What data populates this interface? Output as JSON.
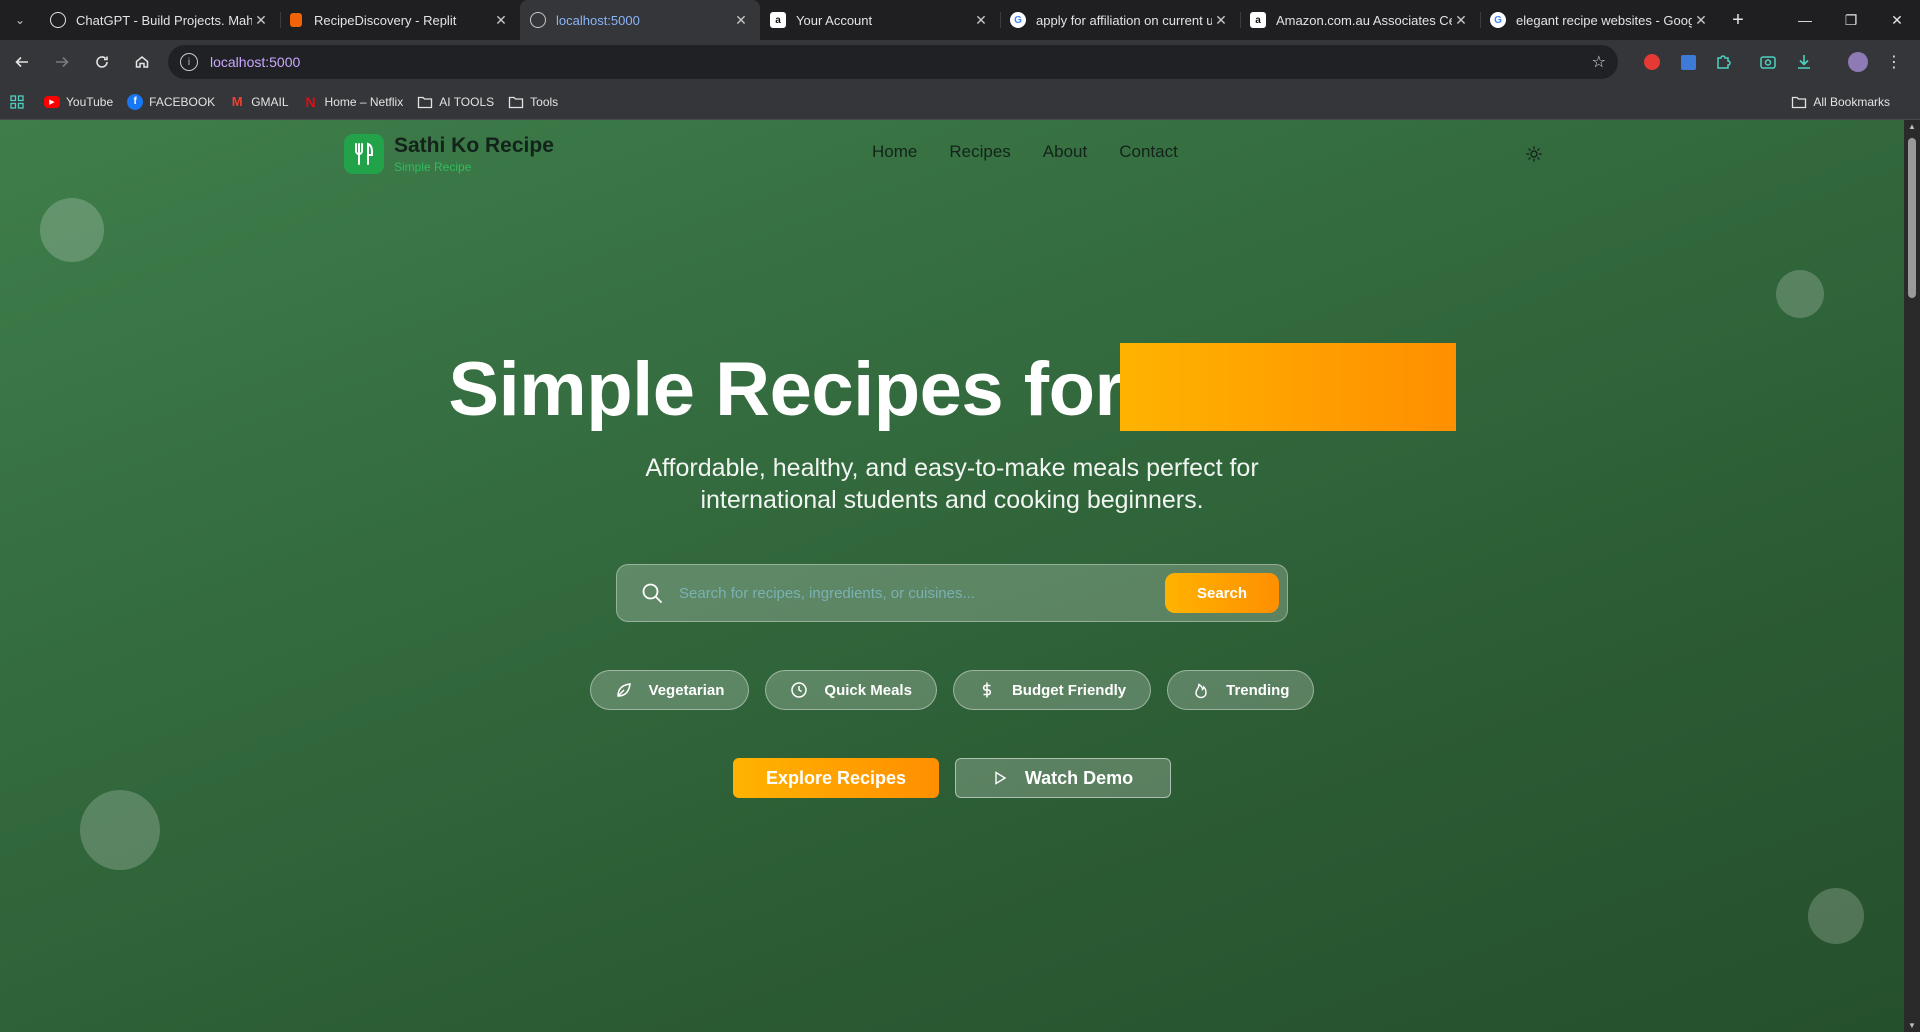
{
  "browser": {
    "tabs": [
      {
        "title": "ChatGPT - Build Projects. Mahir",
        "favicon": "openai-icon",
        "active": false
      },
      {
        "title": "RecipeDiscovery - Replit",
        "favicon": "replit-icon",
        "active": false
      },
      {
        "title": "localhost:5000",
        "favicon": "globe-icon",
        "active": true
      },
      {
        "title": "Your Account",
        "favicon": "amazon-icon",
        "active": false
      },
      {
        "title": "apply for affiliation on current u",
        "favicon": "google-icon",
        "active": false
      },
      {
        "title": "Amazon.com.au Associates Cen",
        "favicon": "amazon-icon",
        "active": false
      },
      {
        "title": "elegant recipe websites - Goog",
        "favicon": "google-icon",
        "active": false
      }
    ],
    "url": "localhost:5000",
    "bookmarks": [
      {
        "label": "YouTube",
        "icon": "youtube-icon"
      },
      {
        "label": "FACEBOOK",
        "icon": "facebook-icon"
      },
      {
        "label": "GMAIL",
        "icon": "gmail-icon"
      },
      {
        "label": "Home – Netflix",
        "icon": "netflix-icon"
      },
      {
        "label": "AI TOOLS",
        "icon": "folder-icon"
      },
      {
        "label": "Tools",
        "icon": "folder-icon"
      }
    ],
    "all_bookmarks_label": "All Bookmarks"
  },
  "site": {
    "brand": "Sathi Ko Recipe",
    "tagline": "Simple Recipe",
    "nav": [
      "Home",
      "Recipes",
      "About",
      "Contact"
    ],
    "hero": {
      "title": "Simple Recipes for",
      "subtitle_line1": "Affordable, healthy, and easy-to-make meals perfect for",
      "subtitle_line2": "international students and cooking beginners."
    },
    "search": {
      "placeholder": "Search for recipes, ingredients, or cuisines...",
      "button": "Search"
    },
    "filters": [
      {
        "label": "Vegetarian",
        "icon": "leaf-icon"
      },
      {
        "label": "Quick Meals",
        "icon": "clock-icon"
      },
      {
        "label": "Budget Friendly",
        "icon": "dollar-icon"
      },
      {
        "label": "Trending",
        "icon": "flame-icon"
      }
    ],
    "cta": {
      "primary": "Explore Recipes",
      "secondary": "Watch Demo"
    }
  },
  "colors": {
    "accent": "#ff9f00",
    "brand_green": "#22a34a",
    "hero_bg": "#346c3f"
  }
}
